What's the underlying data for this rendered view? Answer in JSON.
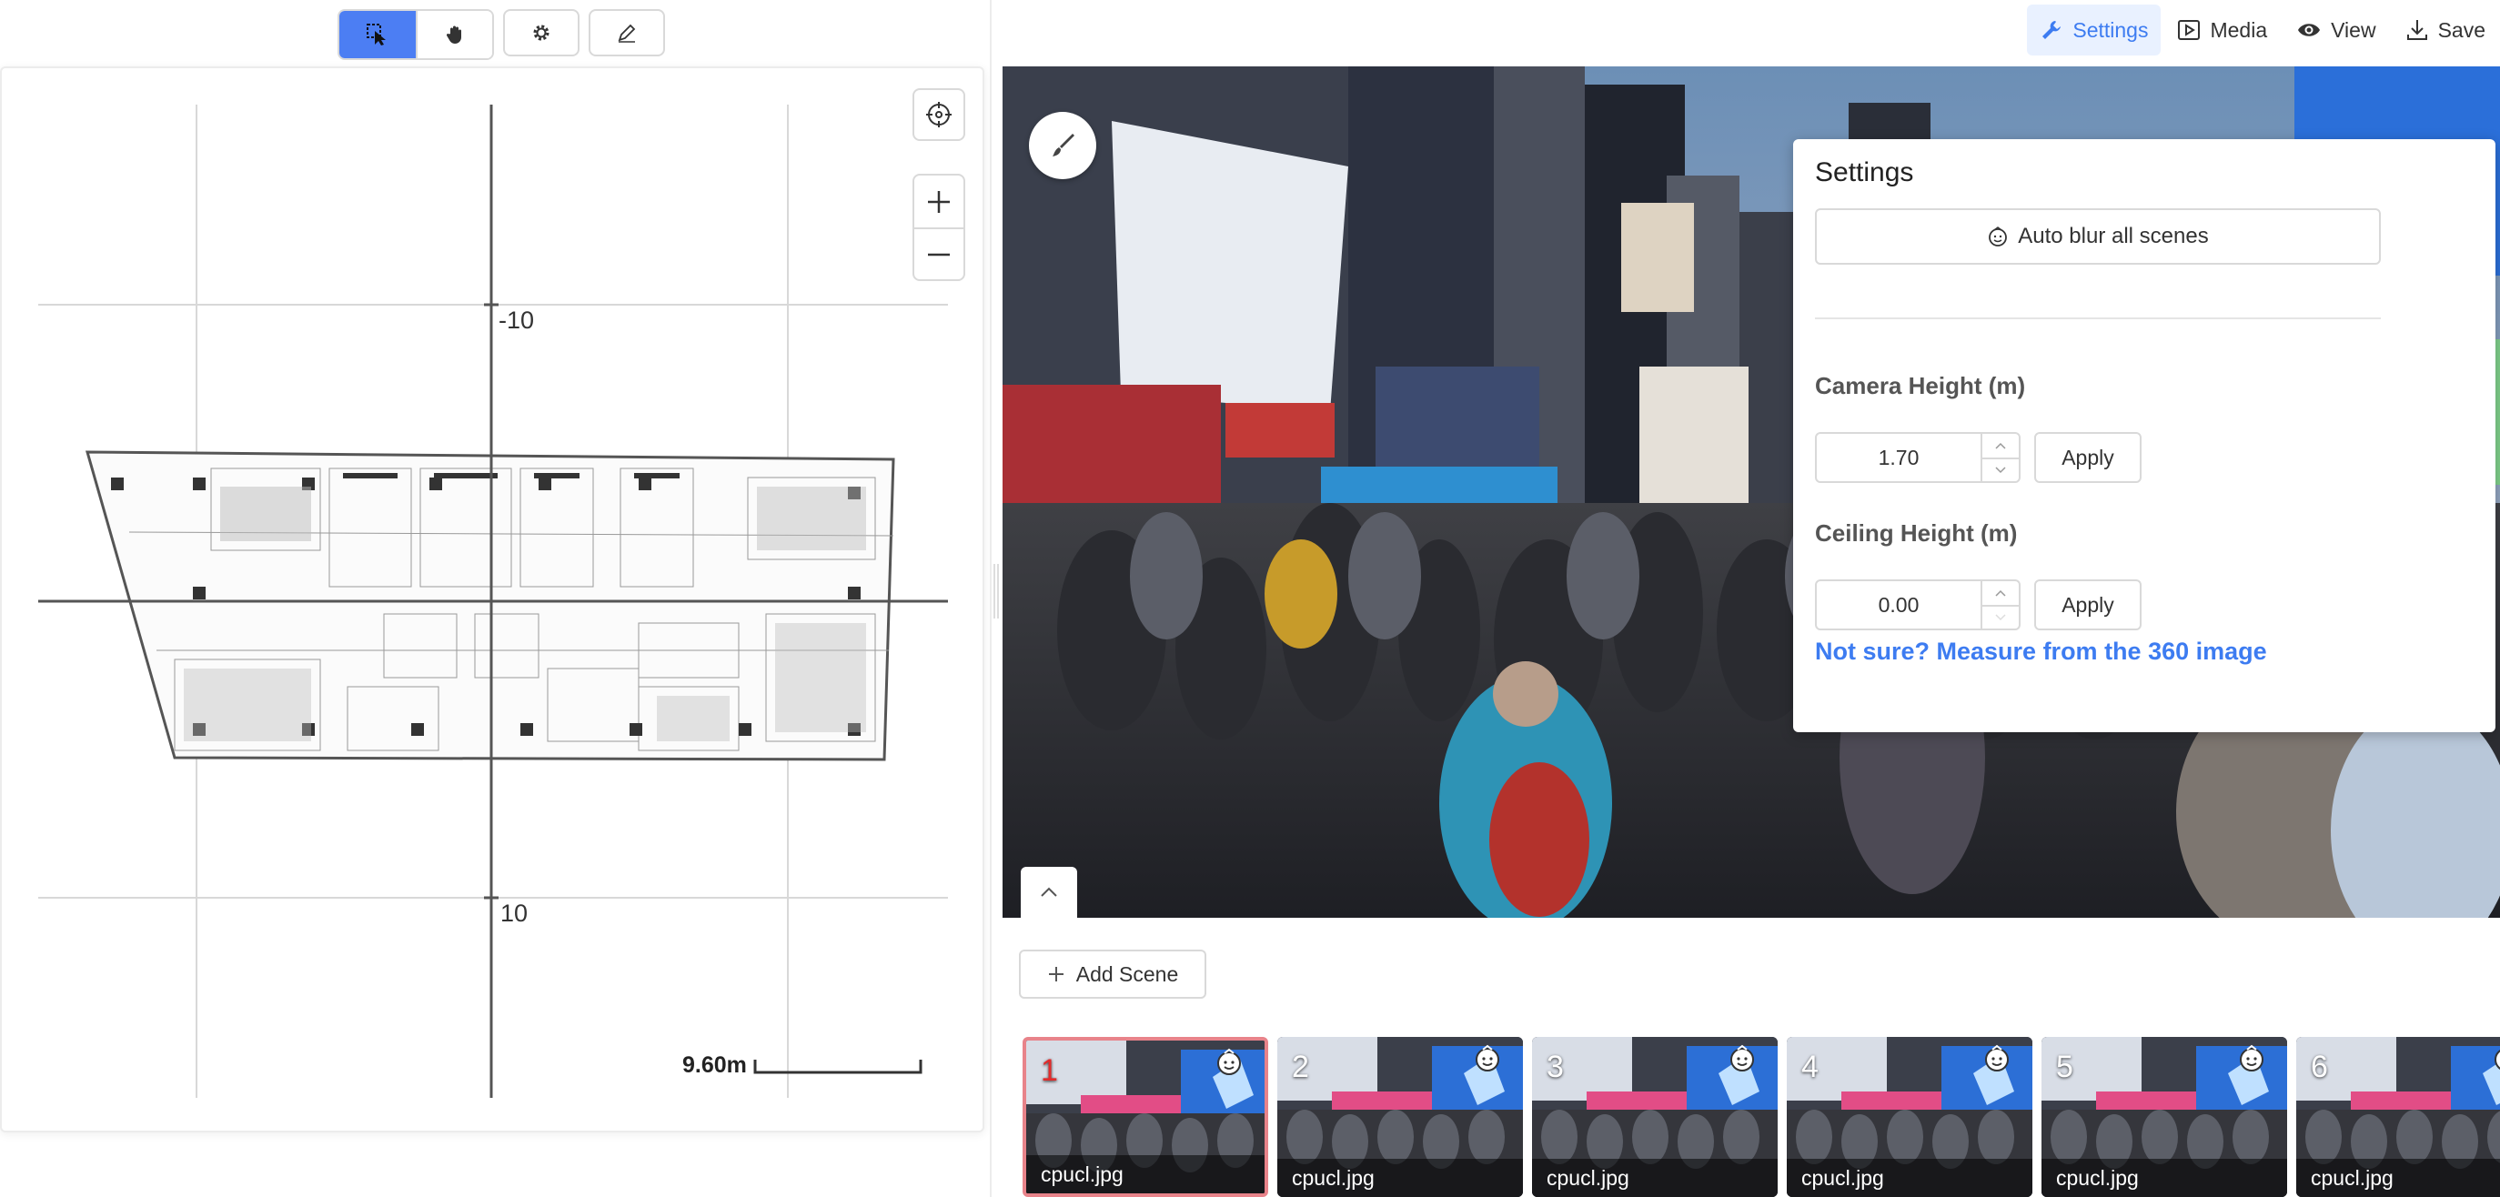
{
  "left_toolbar": {
    "tools": [
      {
        "name": "select-tool",
        "icon": "cursor-select-icon",
        "active": true
      },
      {
        "name": "pan-tool",
        "icon": "hand-icon",
        "active": false
      },
      {
        "name": "settings-tool",
        "icon": "gear-icon",
        "active": false
      },
      {
        "name": "draw-tool",
        "icon": "pencil-icon",
        "active": false
      }
    ]
  },
  "map": {
    "axis_labels": {
      "top": "-10",
      "bottom": "10"
    },
    "scale_label": "9.60m",
    "controls": {
      "locate_icon": "crosshair-icon",
      "zoom_in_icon": "plus-icon",
      "zoom_out_icon": "minus-icon"
    }
  },
  "top_menu": {
    "items": [
      {
        "label": "Settings",
        "icon": "wrench-icon",
        "active": true
      },
      {
        "label": "Media",
        "icon": "media-play-icon",
        "active": false
      },
      {
        "label": "View",
        "icon": "eye-icon",
        "active": false
      },
      {
        "label": "Save",
        "icon": "download-icon",
        "active": false
      }
    ]
  },
  "settings_panel": {
    "title": "Settings",
    "auto_blur_label": "Auto blur all scenes",
    "camera_height_label": "Camera Height (m)",
    "camera_height_value": "1.70",
    "ceiling_height_label": "Ceiling Height (m)",
    "ceiling_height_value": "0.00",
    "apply_label": "Apply",
    "measure_link": "Not sure? Measure from the 360 image"
  },
  "scenes": {
    "add_label": "Add Scene",
    "items": [
      {
        "number": "1",
        "file": "cpucl.jpg",
        "active": true
      },
      {
        "number": "2",
        "file": "cpucl.jpg",
        "active": false
      },
      {
        "number": "3",
        "file": "cpucl.jpg",
        "active": false
      },
      {
        "number": "4",
        "file": "cpucl.jpg",
        "active": false
      },
      {
        "number": "5",
        "file": "cpucl.jpg",
        "active": false
      },
      {
        "number": "6",
        "file": "cpucl.jpg",
        "active": false
      }
    ]
  },
  "colors": {
    "accent": "#4c7ef3",
    "link": "#3d7cf1",
    "active_thumb_border": "#e8838a"
  }
}
